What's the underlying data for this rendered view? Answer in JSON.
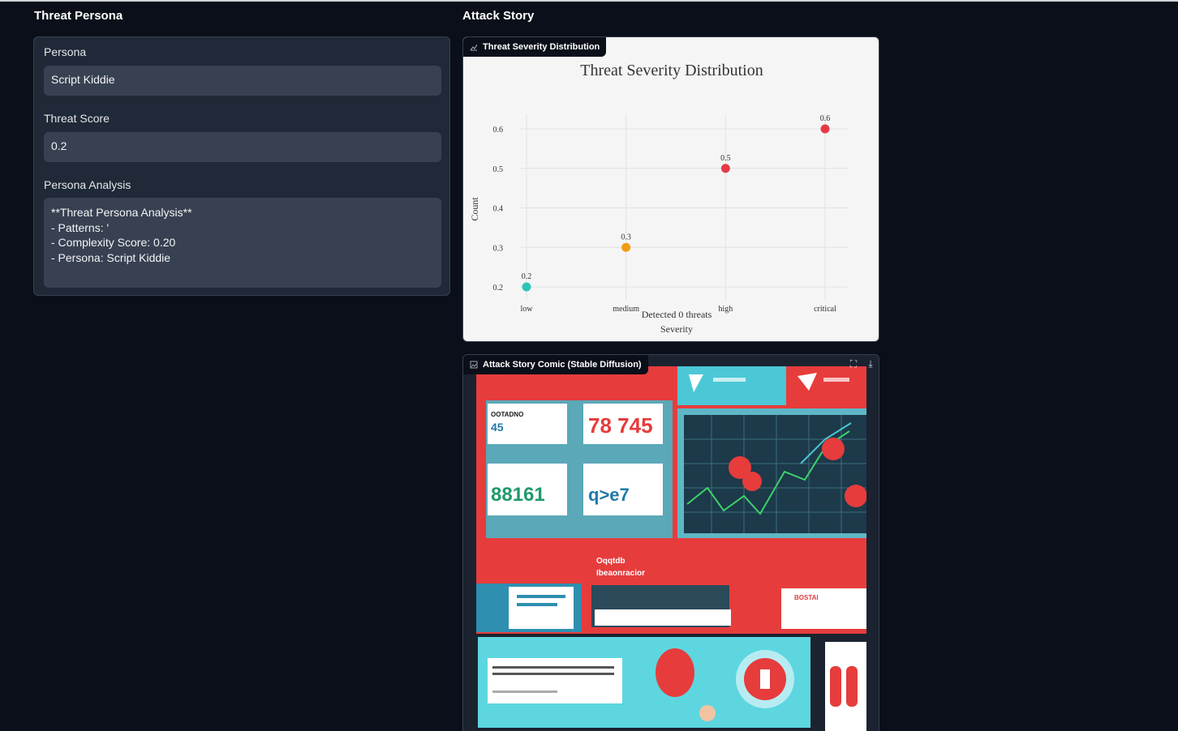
{
  "left_column": {
    "title": "Threat Persona",
    "persona_label": "Persona",
    "persona_value": "Script Kiddie",
    "score_label": "Threat Score",
    "score_value": "0.2",
    "analysis_label": "Persona Analysis",
    "analysis_value": "**Threat Persona Analysis**\n- Patterns: '\n- Complexity Score: 0.20\n- Persona: Script Kiddie"
  },
  "right_column": {
    "title": "Attack Story",
    "chart_tag": "Threat Severity Distribution",
    "comic_tag": "Attack Story Comic (Stable Diffusion)",
    "fullscreen_icon": "fullscreen-icon",
    "download_icon": "download-icon"
  },
  "comic": {
    "counter_1": "78 745",
    "counter_2": "88161",
    "counter_3": "45",
    "counter_4": "q>e7"
  },
  "chart_data": {
    "type": "scatter",
    "title": "Threat Severity Distribution",
    "xlabel": "Severity",
    "ylabel": "Count",
    "annotation": "Detected 0 threats",
    "categories": [
      "low",
      "medium",
      "high",
      "critical"
    ],
    "values": [
      0.2,
      0.3,
      0.5,
      0.6
    ],
    "point_labels": [
      "0.2",
      "0.3",
      "0.5",
      "0.6"
    ],
    "colors": [
      "#2ec4b6",
      "#f39c12",
      "#e63946",
      "#e63946"
    ],
    "yticks": [
      0.2,
      0.3,
      0.4,
      0.5,
      0.6
    ],
    "ytick_labels": [
      "0.2",
      "0.3",
      "0.4",
      "0.5",
      "0.6"
    ],
    "ylim": [
      0.2,
      0.6
    ],
    "grid": true
  }
}
